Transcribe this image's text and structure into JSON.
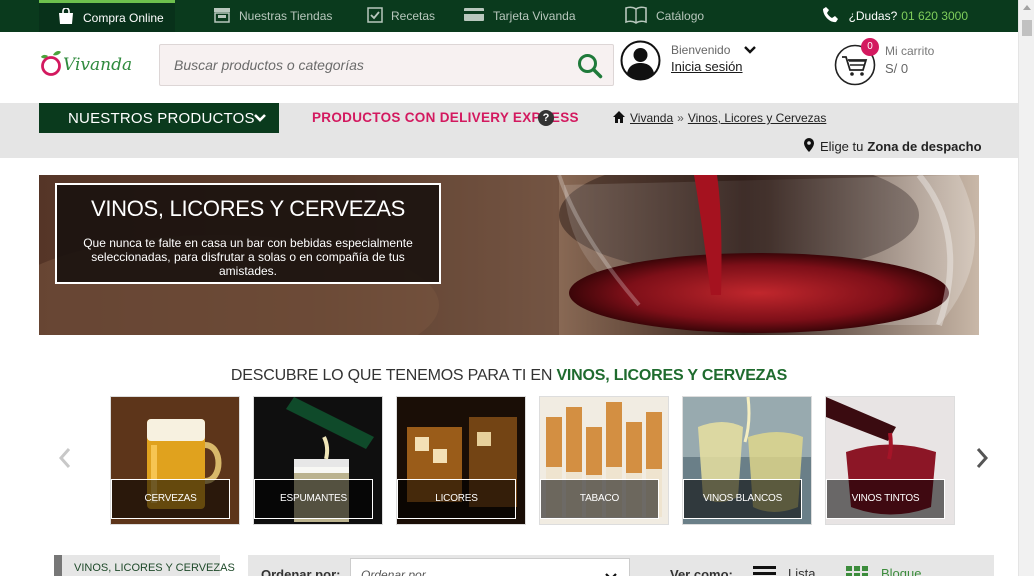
{
  "topbar": {
    "items": [
      {
        "label": "Compra Online",
        "icon": "shopping-bag-icon",
        "active": true
      },
      {
        "label": "Nuestras Tiendas",
        "icon": "store-icon"
      },
      {
        "label": "Recetas",
        "icon": "recipe-check-icon"
      },
      {
        "label": "Tarjeta Vivanda",
        "icon": "card-icon"
      },
      {
        "label": "Catálogo",
        "icon": "book-icon"
      }
    ],
    "help_label": "¿Dudas?",
    "phone": "01 620 3000"
  },
  "header": {
    "logo_text": "Vivanda",
    "search_placeholder": "Buscar productos o categorías",
    "welcome": "Bienvenido",
    "login": "Inicia sesión",
    "cart_label": "Mi carrito",
    "cart_amount": "S/ 0",
    "cart_count": "0"
  },
  "nav": {
    "products_button": "NUESTROS PRODUCTOS",
    "delivery": "PRODUCTOS CON DELIVERY EXPRESS",
    "help": "?",
    "breadcrumb": [
      "Vivanda",
      "Vinos, Licores y Cervezas"
    ],
    "breadcrumb_sep": "»",
    "zone_prefix": "Elige tu",
    "zone_bold": "Zona de despacho"
  },
  "banner": {
    "title": "VINOS, LICORES Y CERVEZAS",
    "text": "Que nunca te falte en casa un bar con bebidas especialmente seleccionadas, para disfrutar a solas o en compañía de tus amistades."
  },
  "discover": {
    "prefix": "DESCUBRE LO QUE TENEMOS PARA TI EN",
    "highlight": "VINOS, LICORES Y CERVEZAS"
  },
  "categories": [
    {
      "label": "CERVEZAS"
    },
    {
      "label": "ESPUMANTES"
    },
    {
      "label": "LICORES"
    },
    {
      "label": "TABACO"
    },
    {
      "label": "VINOS BLANCOS"
    },
    {
      "label": "VINOS TINTOS"
    }
  ],
  "sidebar": {
    "title": "VINOS, LICORES Y CERVEZAS"
  },
  "sort": {
    "label": "Ordenar por:",
    "placeholder": "Ordenar por",
    "view_label": "Ver como:",
    "list": "Lista",
    "grid": "Bloque"
  },
  "colors": {
    "brand_green": "#0a3a1d",
    "accent_pink": "#d3195f",
    "accent_green": "#6dc04d"
  }
}
